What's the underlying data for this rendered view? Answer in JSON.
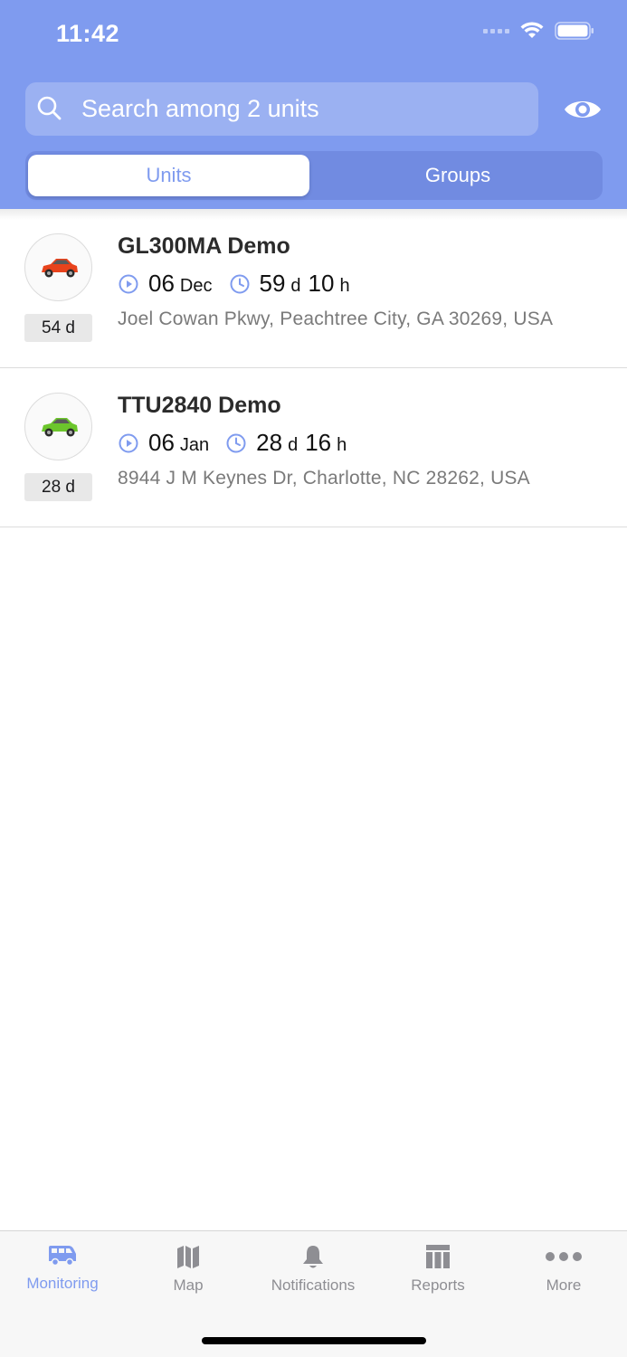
{
  "status_bar": {
    "time": "11:42"
  },
  "search": {
    "placeholder": "Search among 2 units"
  },
  "segments": {
    "units": "Units",
    "groups": "Groups"
  },
  "units": [
    {
      "name": "GL300MA Demo",
      "age": "54 d",
      "date_day": "06",
      "date_month": "Dec",
      "duration_days": "59",
      "duration_days_unit": "d",
      "duration_hours": "10",
      "duration_hours_unit": "h",
      "address": "Joel Cowan Pkwy, Peachtree City, GA 30269, USA",
      "car_color": "#e8431c"
    },
    {
      "name": "TTU2840 Demo",
      "age": "28 d",
      "date_day": "06",
      "date_month": "Jan",
      "duration_days": "28",
      "duration_days_unit": "d",
      "duration_hours": "16",
      "duration_hours_unit": "h",
      "address": "8944 J M Keynes Dr, Charlotte, NC 28262, USA",
      "car_color": "#6cc62c"
    }
  ],
  "tabbar": {
    "items": [
      {
        "label": "Monitoring",
        "icon": "van-icon",
        "active": true
      },
      {
        "label": "Map",
        "icon": "map-icon",
        "active": false
      },
      {
        "label": "Notifications",
        "icon": "bell-icon",
        "active": false
      },
      {
        "label": "Reports",
        "icon": "table-icon",
        "active": false
      },
      {
        "label": "More",
        "icon": "ellipsis-icon",
        "active": false
      }
    ]
  },
  "colors": {
    "accent": "#7f9bef",
    "inactive": "#8e8e93"
  }
}
